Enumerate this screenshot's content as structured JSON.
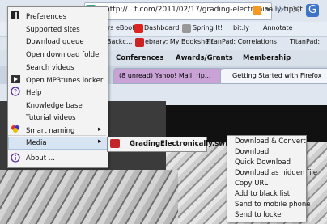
{
  "browser": {
    "url": "http://...t.com/2011/02/17/grading-electronically-tips-t",
    "bookmarks": [
      "rs eBook",
      "Dashboard",
      "Spring It!",
      "bit.ly",
      "Annotate",
      "Backc...",
      "ebrary: My Bookshelf",
      "TitanPad: Correlations",
      "TitanPad:"
    ],
    "toolbar2": [
      "Conferences",
      "Awards/Grants",
      "Membership"
    ],
    "tabs": [
      {
        "label": "(8 unread) Yahoo! Mail, rip..."
      },
      {
        "label": "Getting Started with Firefox"
      }
    ]
  },
  "menu": {
    "items": [
      {
        "label": "Preferences",
        "icon": "pen-tablet-icon"
      },
      {
        "label": "Supported sites"
      },
      {
        "label": "Download queue"
      },
      {
        "label": "Open download folder"
      },
      {
        "label": "Search videos"
      },
      {
        "label": "Open MP3tunes locker",
        "icon": "mp3tunes-icon"
      },
      {
        "label": "Help",
        "icon": "help-icon"
      },
      {
        "label": "Knowledge base"
      },
      {
        "label": "Tutorial videos"
      },
      {
        "label": "Smart naming",
        "icon": "smart-naming-icon",
        "submenu": true
      },
      {
        "label": "Media",
        "submenu": true,
        "highlighted": true
      },
      {
        "label": "About ...",
        "icon": "info-icon"
      }
    ]
  },
  "media_submenu": {
    "item": "GradingElectronically.swf"
  },
  "file_submenu": {
    "items": [
      "Download & Convert",
      "Download",
      "Quick Download",
      "Download as hidden file",
      "Copy URL",
      "Add to black list",
      "Send to mobile phone",
      "Send to locker"
    ]
  }
}
